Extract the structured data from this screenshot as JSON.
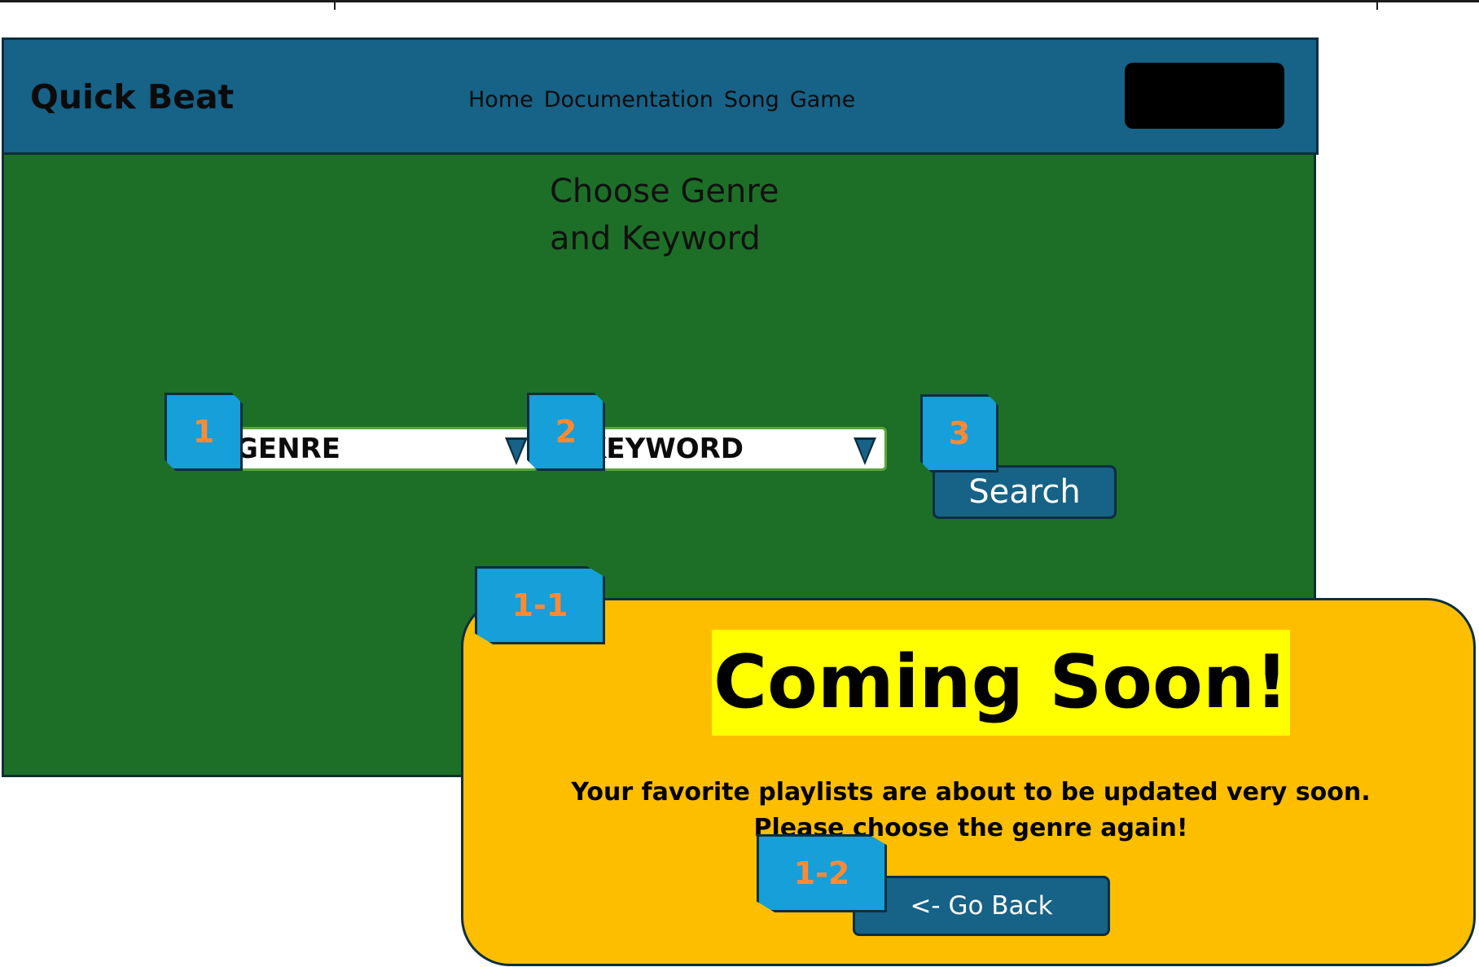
{
  "navbar": {
    "brand": "Quick Beat",
    "links": [
      "Home",
      "Documentation",
      "Song",
      "Game"
    ]
  },
  "main": {
    "heading_line1": "Choose Genre",
    "heading_line2": "and Keyword",
    "genre_select": "GENRE",
    "keyword_select": "KEYWORD",
    "search_button": "Search"
  },
  "modal": {
    "title": "Coming Soon!",
    "message_line1": "Your favorite playlists are about to be updated very soon.",
    "message_line2": "Please choose the genre again!",
    "back_button": "<- Go Back"
  },
  "callouts": {
    "c1": "1",
    "c2": "2",
    "c3": "3",
    "c1_1": "1-1",
    "c1_2": "1-2"
  },
  "colors": {
    "navbar": "#176287",
    "main_bg": "#1d6f27",
    "modal_bg": "#fdbe00",
    "highlight": "#ffff00",
    "callout": "#169fd9",
    "callout_text": "#ff8a33"
  }
}
